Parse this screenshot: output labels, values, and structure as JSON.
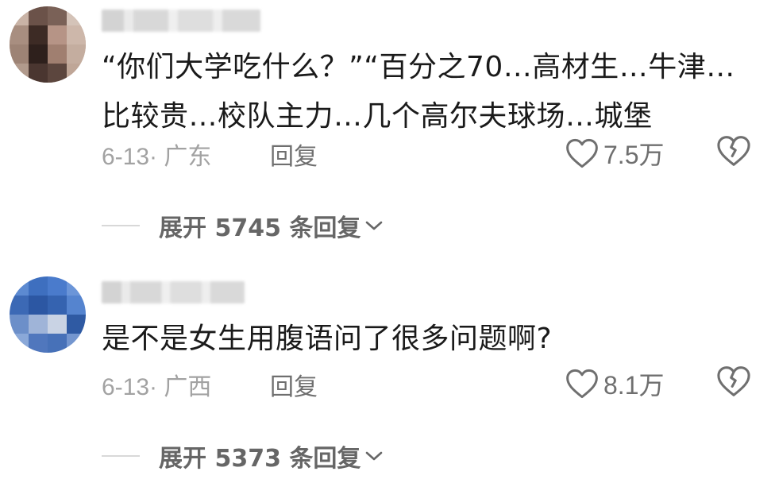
{
  "comments": [
    {
      "text": "“你们大学吃什么？”“百分之70…高材生…牛津…比较贵…校队主力…几个高尔夫球场…城堡",
      "date_location": "6-13· 广东",
      "reply_label": "回复",
      "like_count": "7.5万",
      "expand_label": "展开 5745 条回复"
    },
    {
      "text": "是不是女生用腹语问了很多问题啊?",
      "date_location": "6-13· 广西",
      "reply_label": "回复",
      "like_count": "8.1万",
      "expand_label": "展开 5373 条回复"
    }
  ],
  "colors": {
    "text": "#1a1a1a",
    "meta": "#a2a2a2",
    "action": "#6f6f6f"
  },
  "icons": [
    "heart-outline-icon",
    "broken-heart-icon",
    "chevron-down-icon"
  ]
}
